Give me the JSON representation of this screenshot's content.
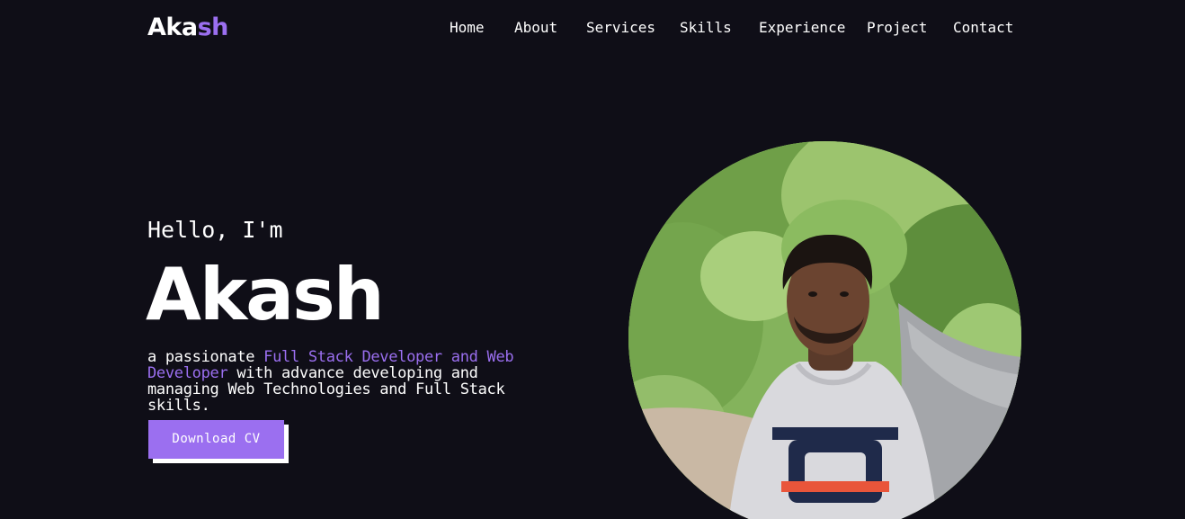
{
  "logo": {
    "part1": "Aka",
    "part2": "sh"
  },
  "nav": {
    "items": [
      {
        "label": "Home"
      },
      {
        "label": "About"
      },
      {
        "label": "Services"
      },
      {
        "label": "Skills"
      },
      {
        "label": "Experience"
      },
      {
        "label": "Project"
      },
      {
        "label": "Contact"
      }
    ]
  },
  "hero": {
    "greeting": "Hello, I'm",
    "name": "Akash",
    "tagline_prefix": "a passionate ",
    "tagline_highlight": "Full Stack Developer and Web Developer",
    "tagline_suffix": " with advance developing and managing Web Technologies and Full Stack skills.",
    "cv_label": "Download CV"
  },
  "colors": {
    "background": "#0f0e17",
    "accent": "#9b6ff0",
    "text": "#ffffff"
  }
}
